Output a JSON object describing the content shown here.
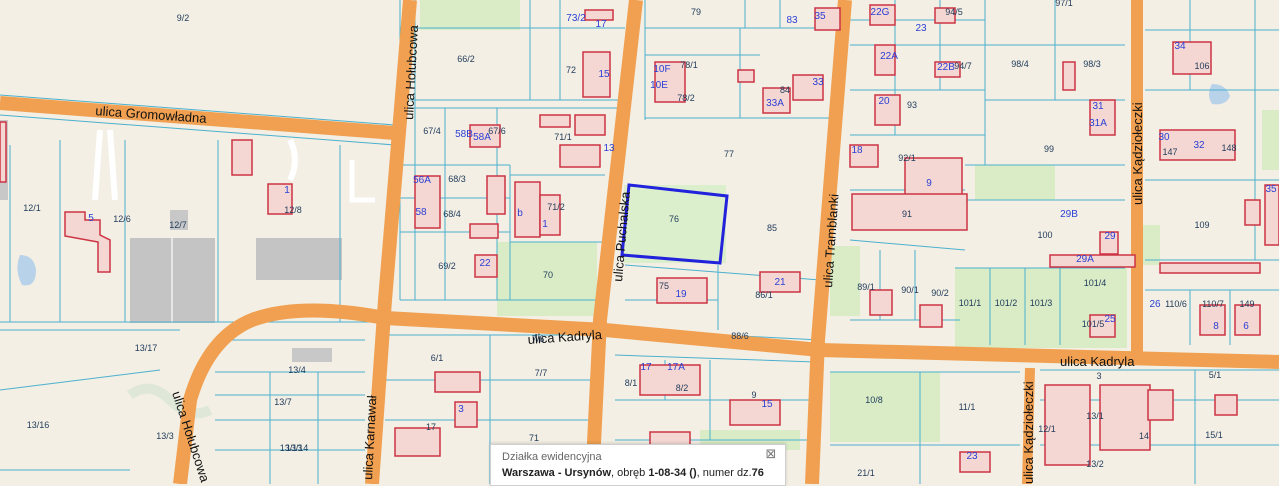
{
  "map": {
    "streets": [
      "ulica Gromowładna",
      "ulica Hołubcowa",
      "ulica Karnawał",
      "ulica Puchalska",
      "ulica Tramblanki",
      "ulica Kądziołeczki",
      "ulica Kadryla",
      "ulica Kadryla",
      "ulica Hołubcowa",
      "ulica Kądziołeczki"
    ],
    "parcels": [
      "9/2",
      "66/2",
      "72",
      "79",
      "78/1",
      "78/2",
      "84",
      "77",
      "76",
      "85",
      "75",
      "86/1",
      "88/6",
      "70",
      "71/1",
      "71/2",
      "67/4",
      "67/6",
      "68/3",
      "68/4",
      "69/2",
      "12/1",
      "12/6",
      "12/7",
      "12/8",
      "13/17",
      "13/4",
      "13/7",
      "13/3",
      "13/16",
      "13/14",
      "13/13",
      "6/1",
      "7/6",
      "7/7",
      "8/1",
      "8/2",
      "9",
      "10/8",
      "11/1",
      "21/1",
      "89/1",
      "90/1",
      "90/2",
      "91",
      "92/1",
      "93",
      "94/5",
      "94/7",
      "98/4",
      "98/3",
      "97/1",
      "99",
      "100",
      "101/1",
      "101/2",
      "101/3",
      "101/4",
      "101/5",
      "106",
      "109",
      "110/6",
      "110/7",
      "147",
      "148",
      "149",
      "5/1",
      "14",
      "15/1",
      "13/1",
      "12/1",
      "13/2",
      "3",
      "17",
      "71"
    ],
    "building_numbers": [
      "73/2",
      "17",
      "15",
      "10F",
      "10E",
      "83",
      "35",
      "33",
      "33A",
      "22G",
      "23",
      "22A",
      "22B",
      "20",
      "18",
      "9",
      "29",
      "29A",
      "29B",
      "31",
      "31A",
      "34",
      "30",
      "32",
      "1",
      "5",
      "58B",
      "58A",
      "56A",
      "58",
      "22",
      "b",
      "1",
      "21",
      "17",
      "17A",
      "15",
      "3",
      "23",
      "26",
      "8",
      "6",
      "25",
      "35",
      "13",
      "19"
    ]
  },
  "popup": {
    "title": "Działka ewidencyjna",
    "location": "Warszawa - Ursynów",
    "sep1": ", obręb ",
    "obreb": "1-08-34 ()",
    "sep2": ", numer dz.",
    "number": "76",
    "close_glyph": "⊠"
  },
  "colors": {
    "road": "#f0a050",
    "parcel_line": "#4bb0cf",
    "building": "#cc3344",
    "selection": "#2222dd",
    "green": "#d8ecc5"
  }
}
